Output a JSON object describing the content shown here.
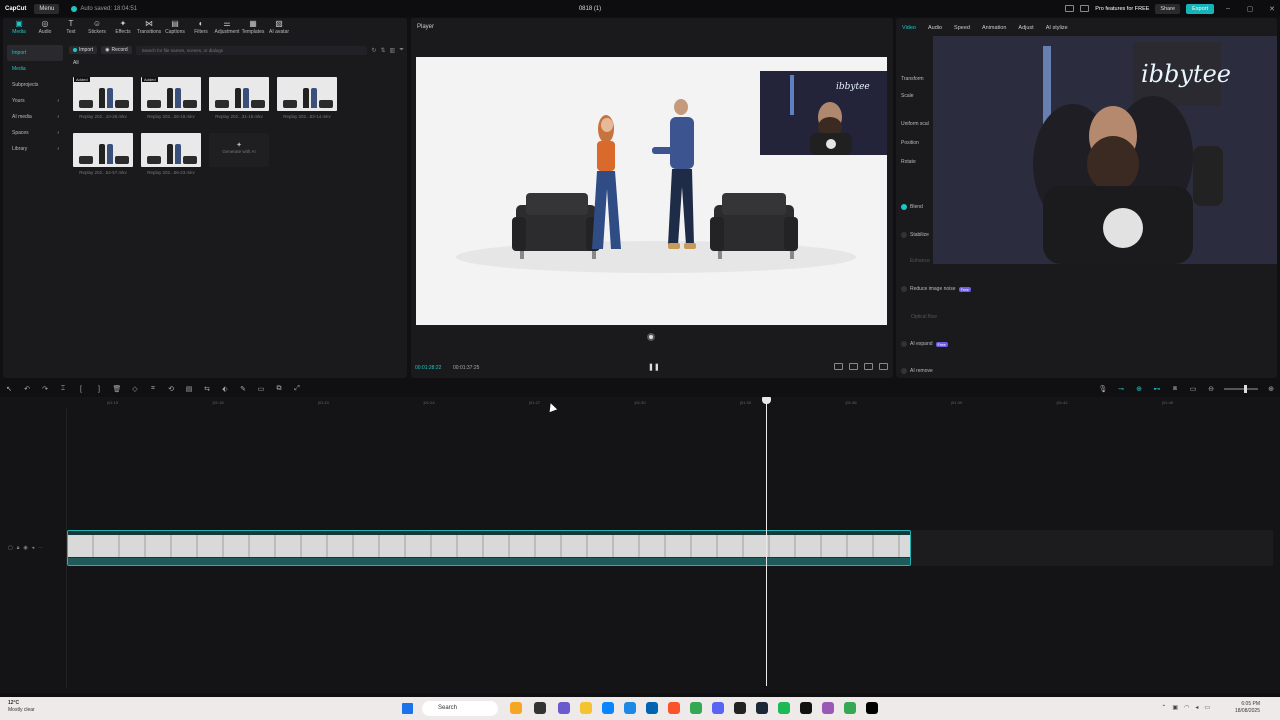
{
  "titlebar": {
    "logo": "CapCut",
    "menu": "Menu",
    "autosave": "Auto saved: 18:04:51",
    "project_title": "0818 (1)",
    "pro": "Pro features for FREE",
    "share": "Share",
    "export": "Export"
  },
  "toolbar": {
    "tools": [
      {
        "label": "Media",
        "icon": "▣"
      },
      {
        "label": "Audio",
        "icon": "◎"
      },
      {
        "label": "Text",
        "icon": "T"
      },
      {
        "label": "Stickers",
        "icon": "☺"
      },
      {
        "label": "Effects",
        "icon": "✦"
      },
      {
        "label": "Transitions",
        "icon": "⋈"
      },
      {
        "label": "Captions",
        "icon": "▤"
      },
      {
        "label": "Filters",
        "icon": "◐"
      },
      {
        "label": "Adjustment",
        "icon": "⚌"
      },
      {
        "label": "Templates",
        "icon": "▦"
      },
      {
        "label": "AI avatar",
        "icon": "▧"
      }
    ]
  },
  "sidebar": {
    "items": [
      {
        "label": "Import"
      },
      {
        "label": "Media"
      },
      {
        "label": "Subprojects"
      },
      {
        "label": "Yours"
      },
      {
        "label": "AI media"
      },
      {
        "label": "Spaces"
      },
      {
        "label": "Library"
      }
    ]
  },
  "media": {
    "import_label": "Import",
    "record_label": "Record",
    "search_placeholder": "Search for file names, scenes, or dialogs",
    "all_label": "All",
    "thumbs": [
      {
        "caption": "Replay 202...10-26.mkv",
        "tag": "Added"
      },
      {
        "caption": "Replay 202...26-19.mkv",
        "tag": "Added"
      },
      {
        "caption": "Replay 202...31-15.mkv",
        "tag": ""
      },
      {
        "caption": "Replay 202...53-14.mkv",
        "tag": ""
      },
      {
        "caption": "Replay 202...54-57.mkv",
        "tag": ""
      },
      {
        "caption": "Replay 202...56-23.mkv",
        "tag": ""
      }
    ],
    "generate_label": "Generate with AI"
  },
  "player": {
    "title": "Player",
    "current_time": "00:01:28:22",
    "total_time": "00:01:37:25",
    "pip_text": "ibbytee"
  },
  "rightpanel": {
    "tabs": [
      {
        "label": "Video"
      },
      {
        "label": "Audio"
      },
      {
        "label": "Speed"
      },
      {
        "label": "Animation"
      },
      {
        "label": "Adjust"
      },
      {
        "label": "AI stylize"
      }
    ],
    "props": {
      "transform": "Transform",
      "scale": "Scale",
      "uniform": "Uniform scal",
      "position": "Position",
      "rotate": "Rotate",
      "blend": "Blend",
      "stabilize": "Stabilize",
      "enhance": "Enhance",
      "reduce_noise": "Reduce image noise",
      "optical_flow": "Optical flow",
      "ai_expand": "AI expand",
      "ai_remove": "AI remove",
      "free_badge": "Free"
    },
    "facecam_text": "ibbytee"
  },
  "timeline": {
    "ticks": [
      "|01:15",
      "|01:18",
      "|01:21",
      "|01:24",
      "|01:27",
      "|01:30",
      "|01:33",
      "|01:36",
      "|01:39",
      "|01:42",
      "|01:45"
    ]
  },
  "taskbar": {
    "temp": "12°C",
    "weather": "Mostly clear",
    "search": "Search",
    "time": "6:05 PM",
    "date": "18/08/2025"
  }
}
